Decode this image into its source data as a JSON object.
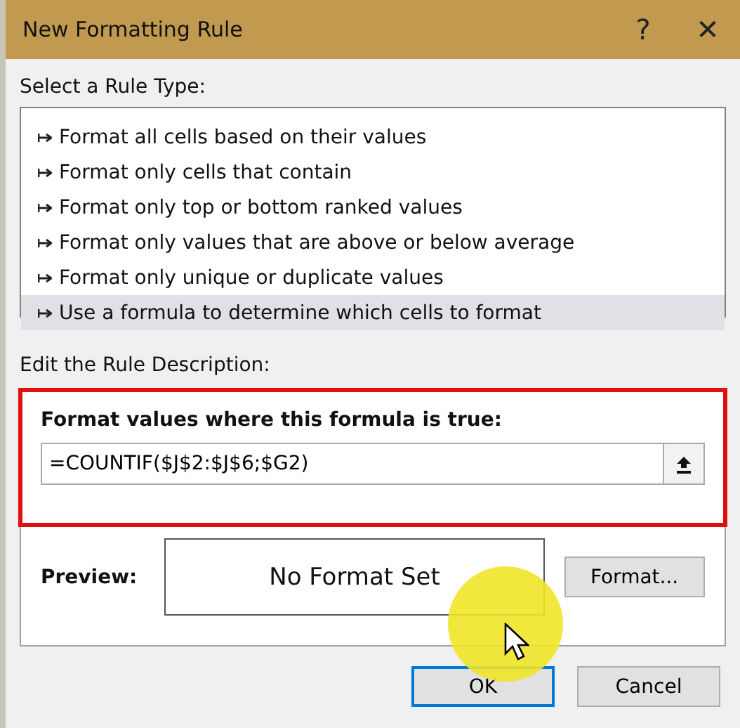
{
  "window": {
    "title": "New Formatting Rule",
    "help": "?",
    "close": "✕"
  },
  "rule_type": {
    "label": "Select a Rule Type:",
    "items": [
      {
        "label": "Format all cells based on their values",
        "selected": false
      },
      {
        "label": "Format only cells that contain",
        "selected": false
      },
      {
        "label": "Format only top or bottom ranked values",
        "selected": false
      },
      {
        "label": "Format only values that are above or below average",
        "selected": false
      },
      {
        "label": "Format only unique or duplicate values",
        "selected": false
      },
      {
        "label": "Use a formula to determine which cells to format",
        "selected": true
      }
    ]
  },
  "description": {
    "label": "Edit the Rule Description:",
    "formula_label": "Format values where this formula is true:",
    "formula": "=COUNTIF($J$2:$J$6;$G2)",
    "highlighted": true,
    "preview_label": "Preview:",
    "preview_text": "No Format Set",
    "format_button": "Format..."
  },
  "buttons": [
    {
      "label": "OK",
      "default": true
    },
    {
      "label": "Cancel",
      "default": false
    }
  ]
}
